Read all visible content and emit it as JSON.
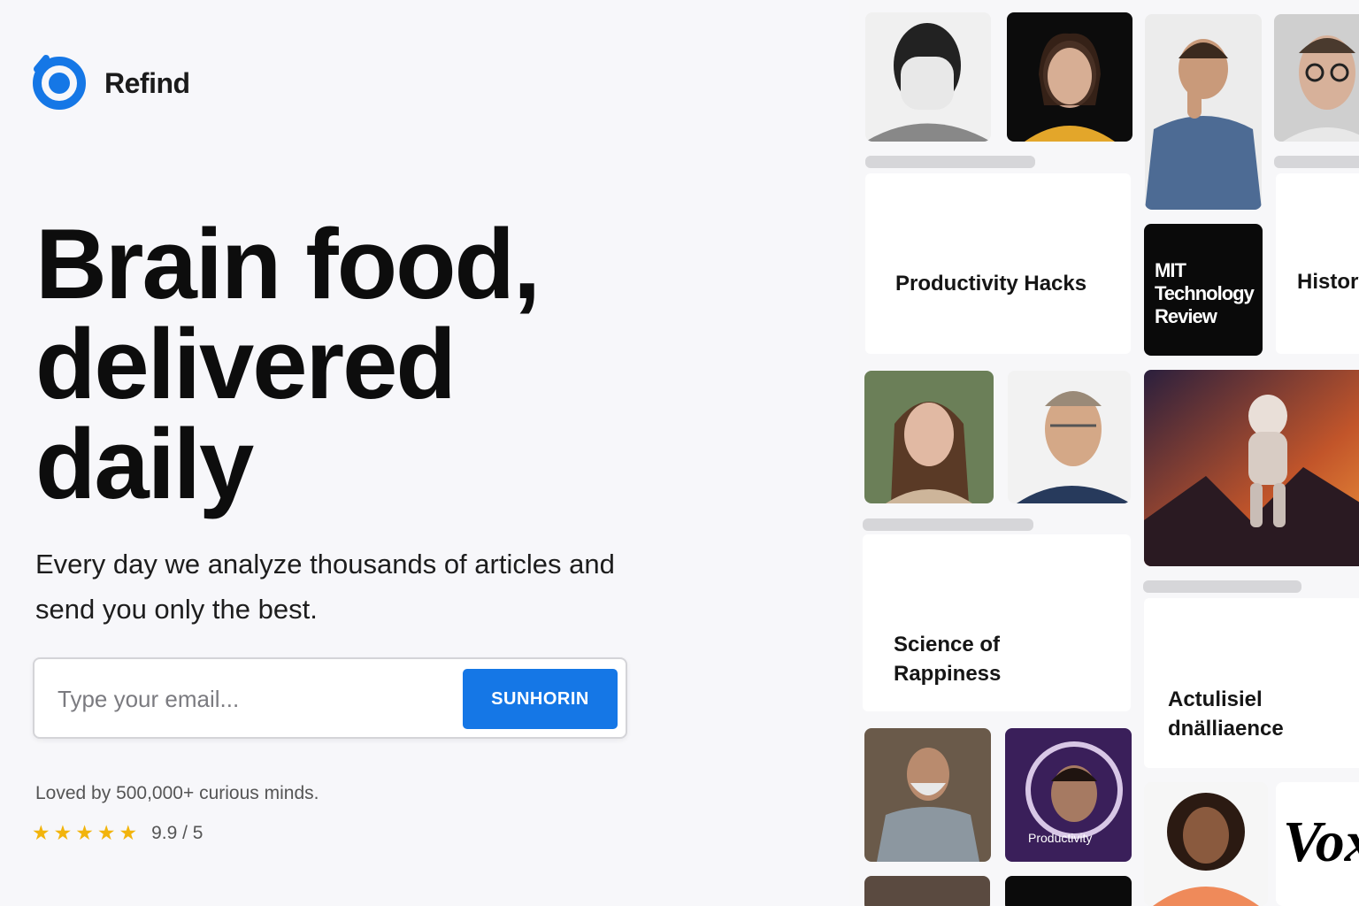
{
  "brand": {
    "name": "Refind",
    "accent": "#1577e6"
  },
  "hero": {
    "headline": "Brain food, delivered daily",
    "subtitle": "Every day we analyze thousands of articles and send you only the best."
  },
  "signup": {
    "placeholder": "Type your email...",
    "button_label": "SUNHORIN"
  },
  "social_proof": {
    "text": "Loved by 500,000+ curious minds.",
    "rating_text": "9.9 / 5",
    "stars": 5
  },
  "gallery": {
    "cards": {
      "productivity": "Productivity Hacks",
      "history": "History of Food",
      "science": "Science of Rappiness",
      "artificial": "Actulisiel dnälliaence"
    },
    "mit_logo": "MIT\nTechnology\nReview",
    "vox_logo": "Vox",
    "overlay": "Productivity"
  }
}
